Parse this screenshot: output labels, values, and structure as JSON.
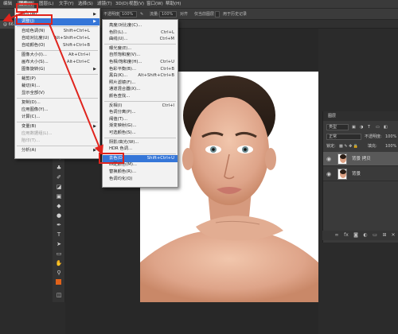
{
  "menubar": {
    "items": [
      {
        "label": "编辑"
      },
      {
        "label": "图像(I)"
      },
      {
        "label": "图层(L)"
      },
      {
        "label": "文字(Y)"
      },
      {
        "label": "选择(S)"
      },
      {
        "label": "滤镜(T)"
      },
      {
        "label": "3D(D)"
      },
      {
        "label": "视图(V)"
      },
      {
        "label": "窗口(W)"
      },
      {
        "label": "帮助(H)"
      }
    ]
  },
  "options": {
    "opacity_label": "不透明度:",
    "opacity_value": "100%",
    "flow_label": "流量:",
    "flow_value": "100%",
    "align_label": "对齐",
    "sample_label": "仅当前图层",
    "history_label": "用于历史记录"
  },
  "doc_tab": {
    "label": "@ 66.7%(RGB/8)"
  },
  "image_menu": {
    "rows": [
      {
        "label": "模式(M)",
        "shortcut": "",
        "submenu": true,
        "disabled": false
      },
      {
        "label": "调整(J)",
        "shortcut": "",
        "submenu": true,
        "disabled": false
      },
      {
        "label": "自动色调(N)",
        "shortcut": "Shift+Ctrl+L",
        "submenu": false,
        "disabled": false
      },
      {
        "label": "自动对比度(U)",
        "shortcut": "Alt+Shift+Ctrl+L",
        "submenu": false,
        "disabled": false
      },
      {
        "label": "自动颜色(O)",
        "shortcut": "Shift+Ctrl+B",
        "submenu": false,
        "disabled": false
      },
      {
        "label": "图像大小(I)...",
        "shortcut": "Alt+Ctrl+I",
        "submenu": false,
        "disabled": false
      },
      {
        "label": "画布大小(S)...",
        "shortcut": "Alt+Ctrl+C",
        "submenu": false,
        "disabled": false
      },
      {
        "label": "图像旋转(G)",
        "shortcut": "",
        "submenu": true,
        "disabled": false
      },
      {
        "label": "裁剪(P)",
        "shortcut": "",
        "submenu": false,
        "disabled": false
      },
      {
        "label": "裁切(R)...",
        "shortcut": "",
        "submenu": false,
        "disabled": false
      },
      {
        "label": "显示全部(V)",
        "shortcut": "",
        "submenu": false,
        "disabled": false
      },
      {
        "label": "复制(D)...",
        "shortcut": "",
        "submenu": false,
        "disabled": false
      },
      {
        "label": "应用图像(Y)...",
        "shortcut": "",
        "submenu": false,
        "disabled": false
      },
      {
        "label": "计算(C)...",
        "shortcut": "",
        "submenu": false,
        "disabled": false
      },
      {
        "label": "变量(B)",
        "shortcut": "",
        "submenu": true,
        "disabled": false
      },
      {
        "label": "应用数据组(L)...",
        "shortcut": "",
        "submenu": false,
        "disabled": true
      },
      {
        "label": "陷印(T)...",
        "shortcut": "",
        "submenu": false,
        "disabled": true
      },
      {
        "label": "分析(A)",
        "shortcut": "",
        "submenu": true,
        "disabled": false
      }
    ]
  },
  "adjust_menu": {
    "rows": [
      {
        "label": "亮度/对比度(C)...",
        "shortcut": ""
      },
      {
        "label": "色阶(L)...",
        "shortcut": "Ctrl+L"
      },
      {
        "label": "曲线(U)...",
        "shortcut": "Ctrl+M"
      },
      {
        "label": "曝光度(E)...",
        "shortcut": ""
      },
      {
        "label": "自然饱和度(V)...",
        "shortcut": ""
      },
      {
        "label": "色相/饱和度(H)...",
        "shortcut": "Ctrl+U"
      },
      {
        "label": "色彩平衡(B)...",
        "shortcut": "Ctrl+B"
      },
      {
        "label": "黑白(K)...",
        "shortcut": "Alt+Shift+Ctrl+B"
      },
      {
        "label": "照片滤镜(F)...",
        "shortcut": ""
      },
      {
        "label": "通道混合器(X)...",
        "shortcut": ""
      },
      {
        "label": "颜色查找...",
        "shortcut": ""
      },
      {
        "label": "反相(I)",
        "shortcut": "Ctrl+I"
      },
      {
        "label": "色调分离(P)...",
        "shortcut": ""
      },
      {
        "label": "阈值(T)...",
        "shortcut": ""
      },
      {
        "label": "渐变映射(G)...",
        "shortcut": ""
      },
      {
        "label": "可选颜色(S)...",
        "shortcut": ""
      },
      {
        "label": "阴影/高光(W)...",
        "shortcut": ""
      },
      {
        "label": "HDR 色调...",
        "shortcut": ""
      },
      {
        "label": "去色(D)",
        "shortcut": "Shift+Ctrl+U"
      },
      {
        "label": "匹配颜色(M)...",
        "shortcut": ""
      },
      {
        "label": "替换颜色(R)...",
        "shortcut": ""
      },
      {
        "label": "色调均化(Q)",
        "shortcut": ""
      }
    ]
  },
  "layers_panel": {
    "tab_label": "图层",
    "kind_label": "类型",
    "blend_mode": "正常",
    "opacity_label": "不透明度:",
    "opacity_value": "100%",
    "lock_label": "锁定:",
    "fill_label": "填充:",
    "fill_value": "100%",
    "layers": [
      {
        "name": "背景 拷贝"
      },
      {
        "name": "背景"
      }
    ]
  },
  "colors": {
    "highlight": "#3576d8",
    "annotation_red": "#e0241d",
    "foreground_swatch": "#e0621a"
  }
}
